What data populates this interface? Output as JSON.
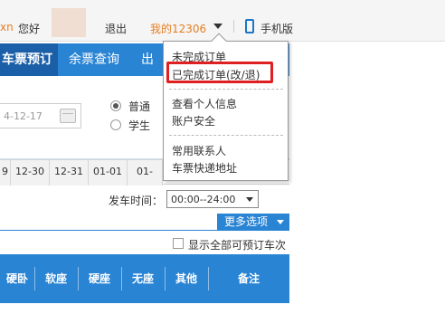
{
  "topbar": {
    "partial_user": "xn",
    "welcome": "您好",
    "logout": "退出",
    "my12306": "我的12306",
    "mobile": "手机版"
  },
  "nav": {
    "tabs": [
      "车票预订",
      "余票查询",
      "出"
    ]
  },
  "search": {
    "date_value": "4-12-17",
    "ticket_types": [
      {
        "label": "普通",
        "selected": true
      },
      {
        "label": "学生",
        "selected": false
      }
    ]
  },
  "date_strip": [
    "9",
    "12-30",
    "12-31",
    "01-01",
    "01-"
  ],
  "filters": {
    "depart_time_label": "发车时间：",
    "depart_time_value": "00:00--24:00",
    "more_options": "更多选项",
    "show_all": "显示全部可预订车次"
  },
  "table_headers": [
    "硬卧",
    "软座",
    "硬座",
    "无座",
    "其他",
    "备注"
  ],
  "dropdown": {
    "items": [
      {
        "label": "未完成订单",
        "highlighted": false
      },
      {
        "label": "已完成订单(改/退)",
        "highlighted": true
      },
      {
        "label": "查看个人信息",
        "highlighted": false
      },
      {
        "label": "账户安全",
        "highlighted": false
      },
      {
        "label": "常用联系人",
        "highlighted": false
      },
      {
        "label": "车票快递地址",
        "highlighted": false
      }
    ]
  },
  "colors": {
    "primary_blue": "#2a84d4",
    "dark_blue": "#1b5fa8",
    "orange": "#e67e22",
    "highlight_red": "#e02020"
  }
}
